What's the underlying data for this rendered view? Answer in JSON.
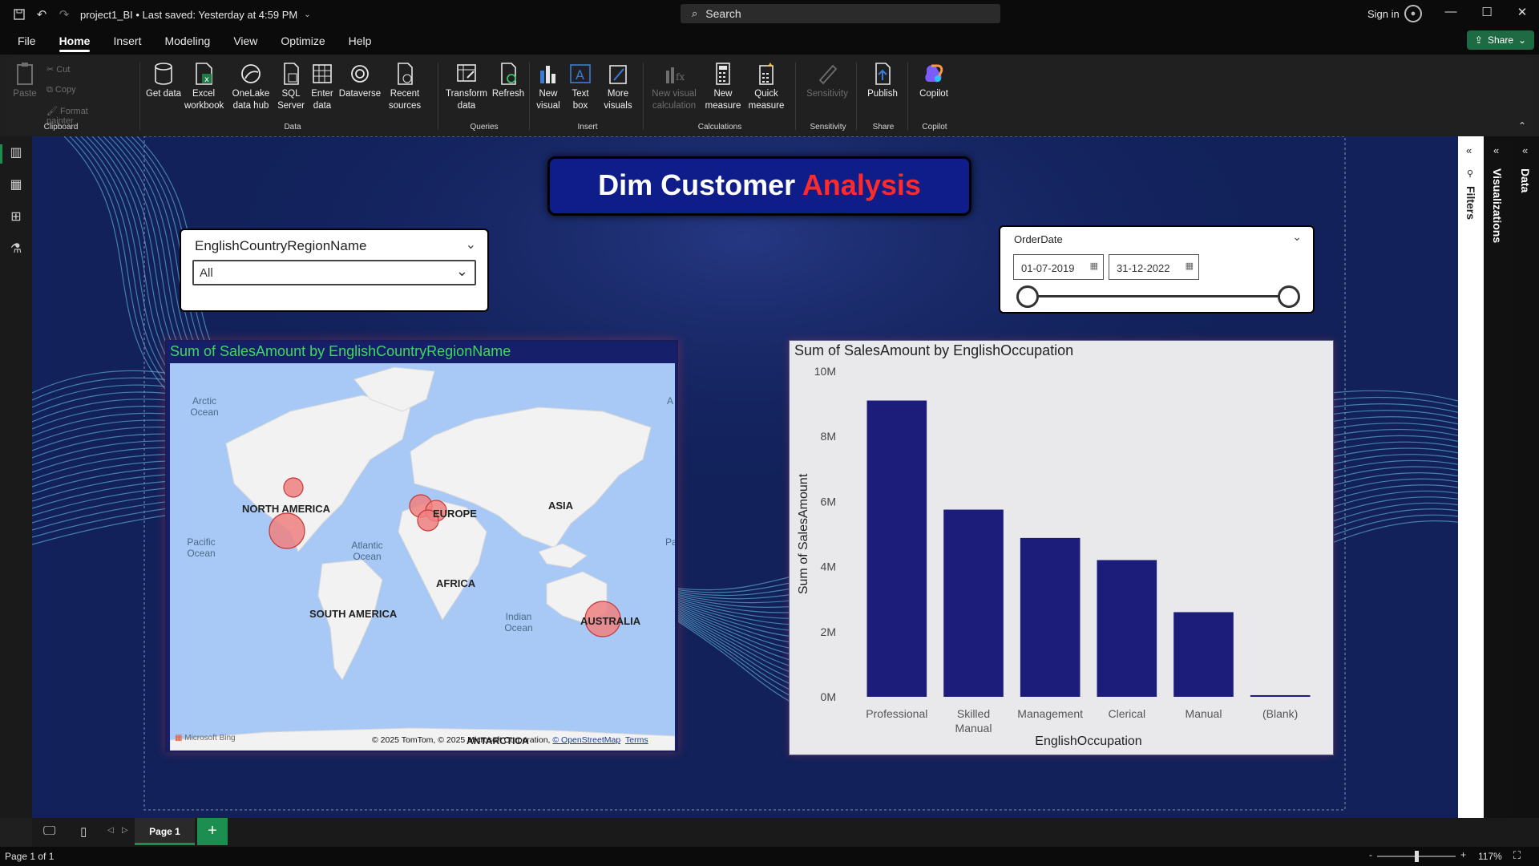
{
  "titlebar": {
    "file_title": "project1_BI • Last saved: Yesterday at 4:59 PM",
    "search_placeholder": "Search",
    "sign_in": "Sign in"
  },
  "menu": {
    "items": [
      "File",
      "Home",
      "Insert",
      "Modeling",
      "View",
      "Optimize",
      "Help"
    ],
    "active": "Home",
    "share": "Share"
  },
  "ribbon": {
    "clipboard": {
      "paste": "Paste",
      "cut": "Cut",
      "copy": "Copy",
      "format_painter": "Format painter",
      "group": "Clipboard"
    },
    "data": {
      "get_data": "Get data",
      "excel": "Excel workbook",
      "onelake": "OneLake data hub",
      "sql": "SQL Server",
      "enter": "Enter data",
      "dataverse": "Dataverse",
      "recent": "Recent sources",
      "group": "Data"
    },
    "queries": {
      "transform": "Transform data",
      "refresh": "Refresh",
      "group": "Queries"
    },
    "insert": {
      "new_visual": "New visual",
      "text_box": "Text box",
      "more_visuals": "More visuals",
      "group": "Insert"
    },
    "calculations": {
      "new_visual_calc": "New visual calculation",
      "new_measure": "New measure",
      "quick_measure": "Quick measure",
      "group": "Calculations"
    },
    "sensitivity": {
      "label": "Sensitivity",
      "group": "Sensitivity"
    },
    "share": {
      "publish": "Publish",
      "group": "Share"
    },
    "copilot": {
      "label": "Copilot",
      "group": "Copilot"
    }
  },
  "report": {
    "title_part1": "Dim Customer ",
    "title_part2": "Analysis",
    "country_slicer": {
      "header": "EnglishCountryRegionName",
      "value": "All"
    },
    "date_slicer": {
      "header": "OrderDate",
      "start": "01-07-2019",
      "end": "31-12-2022"
    },
    "map": {
      "title": "Sum of SalesAmount by EnglishCountryRegionName",
      "labels": {
        "arctic": "Arctic Ocean",
        "na": "NORTH AMERICA",
        "europe": "EUROPE",
        "asia": "ASIA",
        "pacific": "Pacific Ocean",
        "atlantic": "Atlantic Ocean",
        "africa": "AFRICA",
        "sa": "SOUTH AMERICA",
        "indian": "Indian Ocean",
        "australia": "AUSTRALIA",
        "antarctica": "ANTARCTICA",
        "edge_a": "A",
        "edge_pa": "Pa"
      },
      "copyright": "© 2025 TomTom, © 2025 Microsoft Corporation,",
      "osm": "© OpenStreetMap",
      "terms": "Terms",
      "bing": "Microsoft Bing"
    }
  },
  "chart_data": {
    "type": "bar",
    "title": "Sum of SalesAmount by EnglishOccupation",
    "xlabel": "EnglishOccupation",
    "ylabel": "Sum of SalesAmount",
    "categories": [
      "Professional",
      "Skilled Manual",
      "Management",
      "Clerical",
      "Manual",
      "(Blank)"
    ],
    "values": [
      9100000,
      5750000,
      4880000,
      4200000,
      2600000,
      50000
    ],
    "ylim": [
      0,
      10000000
    ],
    "yticks": [
      "0M",
      "2M",
      "4M",
      "6M",
      "8M",
      "10M"
    ],
    "bar_color": "#1c1c7a"
  },
  "panes": {
    "filters": "Filters",
    "visualizations": "Visualizations",
    "data": "Data"
  },
  "bottom": {
    "page_tab": "Page 1",
    "add": "+"
  },
  "status": {
    "page_info": "Page 1 of 1",
    "zoom": "117%",
    "minus": "-",
    "plus": "+"
  }
}
